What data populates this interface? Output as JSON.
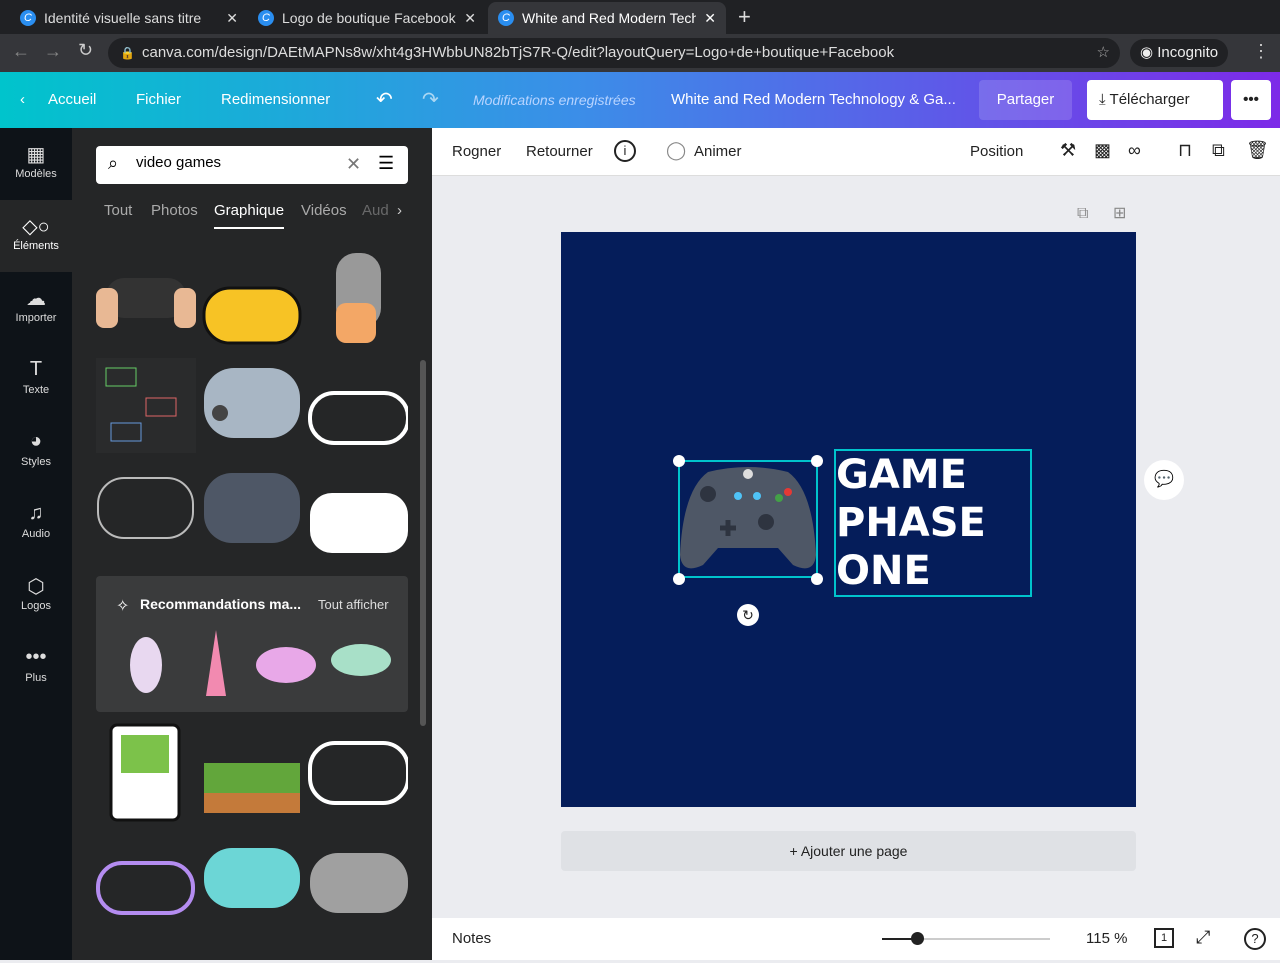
{
  "browser": {
    "tabs": [
      {
        "title": "Identité visuelle sans titre"
      },
      {
        "title": "Logo de boutique Facebook"
      },
      {
        "title": "White and Red Modern Technology"
      }
    ],
    "url": "canva.com/design/DAEtMAPNs8w/xht4g3HWbbUN82bTjS7R-Q/edit?layoutQuery=Logo+de+boutique+Facebook",
    "profile": "Incognito"
  },
  "topbar": {
    "home": "Accueil",
    "file": "Fichier",
    "resize": "Redimensionner",
    "saved": "Modifications enregistrées",
    "title": "White and Red Modern Technology & Ga...",
    "share": "Partager",
    "download": "Télécharger"
  },
  "sidebar": {
    "items": [
      {
        "label": "Modèles"
      },
      {
        "label": "Éléments"
      },
      {
        "label": "Importer"
      },
      {
        "label": "Texte"
      },
      {
        "label": "Styles"
      },
      {
        "label": "Audio"
      },
      {
        "label": "Logos"
      },
      {
        "label": "Plus"
      }
    ]
  },
  "panel": {
    "search_value": "video games",
    "tabs": [
      "Tout",
      "Photos",
      "Graphique",
      "Vidéos",
      "Aud"
    ],
    "reco_title": "Recommandations ma...",
    "reco_all": "Tout afficher"
  },
  "toolbar": {
    "crop": "Rogner",
    "flip": "Retourner",
    "animate": "Animer",
    "position": "Position"
  },
  "design": {
    "text_lines": [
      "GAME",
      "PHASE",
      "ONE"
    ],
    "bg_color": "#051d5a"
  },
  "add_page": "+ Ajouter une page",
  "footer": {
    "notes": "Notes",
    "zoom": "115 %",
    "page_num": "1",
    "zoom_fraction": 0.2
  }
}
